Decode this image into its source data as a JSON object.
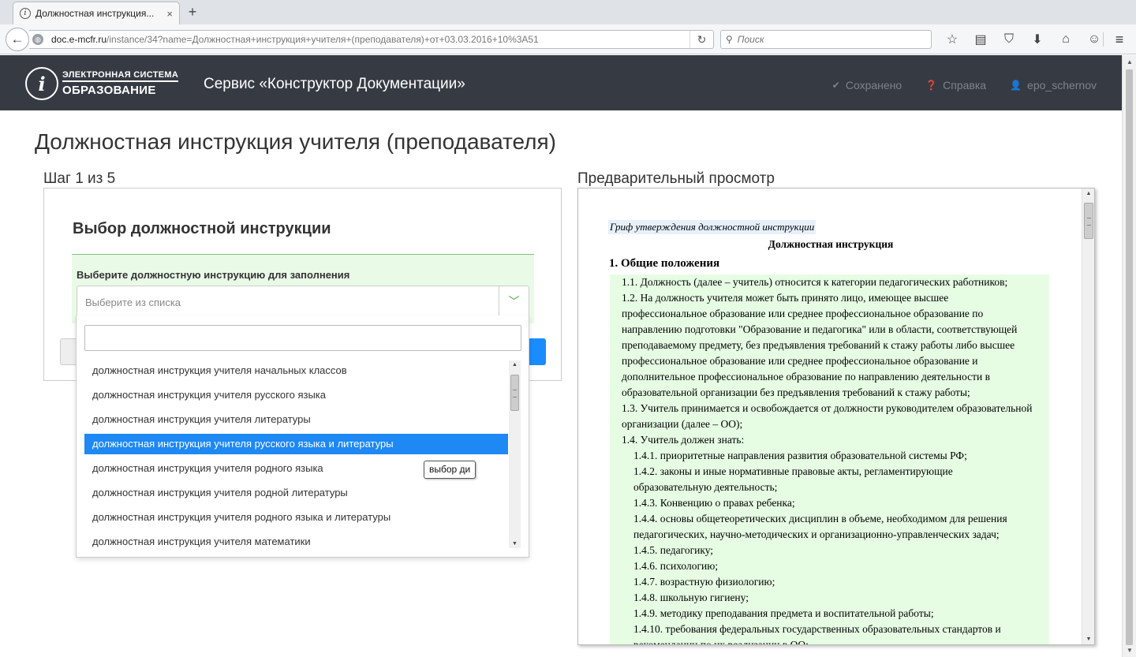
{
  "browser": {
    "tab_title": "Должностная инструкция...",
    "tab_close": "×",
    "new_tab": "+",
    "url_domain": "doc.e-mcfr.ru",
    "url_path": "/instance/34?name=Должностная+инструкция+учителя+(преподавателя)+от+03.03.2016+10%3A51",
    "search_placeholder": "Поиск"
  },
  "header": {
    "logo_line1": "ЭЛЕКТРОННАЯ СИСТЕМА",
    "logo_line2": "ОБРАЗОВАНИЕ",
    "logo_mark": "i",
    "service_title": "Сервис «Конструктор Документации»",
    "saved": "Сохранено",
    "help": "Справка",
    "user": "epo_schernov"
  },
  "page": {
    "title": "Должностная инструкция учителя (преподавателя)",
    "step": "Шаг 1 из 5",
    "preview_label": "Предварительный просмотр"
  },
  "step_panel": {
    "heading": "Выбор должностной инструкции",
    "field_label": "Выберите должностную инструкцию для заполнения",
    "select_placeholder": "Выберите из списка"
  },
  "dropdown": {
    "items": [
      "должностная инструкция учителя начальных классов",
      "должностная инструкция учителя русского языка",
      "должностная инструкция учителя литературы",
      "должностная инструкция учителя русского языка и литературы",
      "должностная инструкция учителя родного языка",
      "должностная инструкция учителя родной литературы",
      "должностная инструкция учителя родного языка и литературы",
      "должностная инструкция учителя математики"
    ],
    "selected_index": 3,
    "tooltip": "выбор ди"
  },
  "preview": {
    "grif": "Гриф утверждения должностной инструкции",
    "doc_title": "Должностная инструкция",
    "section_title": "1. Общие положения",
    "lines": [
      "1.1. Должность (далее – учитель) относится к категории педагогических работников;",
      "1.2. На должность учителя может быть принято лицо, имеющее высшее",
      "профессиональное образование или среднее профессиональное образование по",
      "направлению подготовки \"Образование и педагогика\" или в области, соответствующей",
      "преподаваемому предмету, без предъявления требований к стажу работы либо высшее",
      "профессиональное образование или среднее профессиональное образование и",
      "дополнительное профессиональное образование по направлению деятельности в",
      "образовательной организации без предъявления требований к стажу работы;",
      "1.3. Учитель принимается и освобождается от должности руководителем образовательной",
      "организации (далее – ОО);",
      "1.4. Учитель должен знать:",
      "1.4.1. приоритетные направления развития образовательной системы РФ;",
      "1.4.2. законы и иные нормативные правовые акты, регламентирующие",
      "образовательную деятельность;",
      "1.4.3. Конвенцию о правах ребенка;",
      "1.4.4. основы общетеоретических дисциплин в объеме, необходимом для решения",
      "педагогических, научно-методических и организационно-управленческих задач;",
      "1.4.5. педагогику;",
      "1.4.6. психологию;",
      "1.4.7. возрастную физиологию;",
      "1.4.8. школьную гигиену;",
      "1.4.9. методику преподавания предмета и воспитательной работы;",
      "1.4.10. требования федеральных государственных образовательных стандартов и",
      "рекомендации по их реализации в ОО;"
    ]
  },
  "colors": {
    "header_bg": "#363b43",
    "accent_blue": "#1e88f4",
    "green_bg": "#e6fde4"
  }
}
